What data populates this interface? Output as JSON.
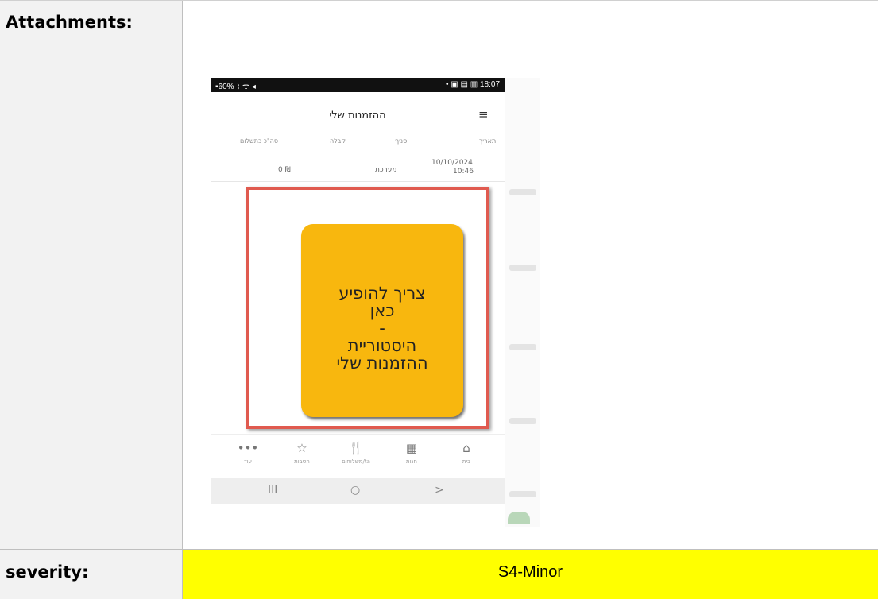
{
  "rows": {
    "attachments_label": "Attachments:",
    "severity_label": "severity:",
    "severity_value": "S4-Minor"
  },
  "phone": {
    "status_left": "▪60% ⌇ ᯤ ◂",
    "status_right": "• ▣ ▤ ▥ 18:07",
    "title": "ההזמנות שלי",
    "columns": [
      "תאריך",
      "סניף",
      "קבלה",
      "סה\"כ כתשלום"
    ],
    "row": {
      "date": "10/10/2024",
      "time": "10:46",
      "branch": "מערכת",
      "total": "0 ₪"
    },
    "callout": "צריך להופיע\nכאן\n-\nהיסטוריית\nההזמנות שלי",
    "nav": [
      {
        "label": "עוד",
        "icon": "•••"
      },
      {
        "label": "הטבות",
        "icon": "☆"
      },
      {
        "label": "משלוחים/ta",
        "icon": "🍴"
      },
      {
        "label": "חנות",
        "icon": "▦"
      },
      {
        "label": "בית",
        "icon": "⌂"
      }
    ],
    "system_buttons": [
      "III",
      "○",
      ">"
    ]
  },
  "colors": {
    "severity_bg": "#ffff00",
    "label_bg": "#f2f2f2",
    "callout_bg": "#f8b70e",
    "highlight_border": "#e05a4f"
  }
}
